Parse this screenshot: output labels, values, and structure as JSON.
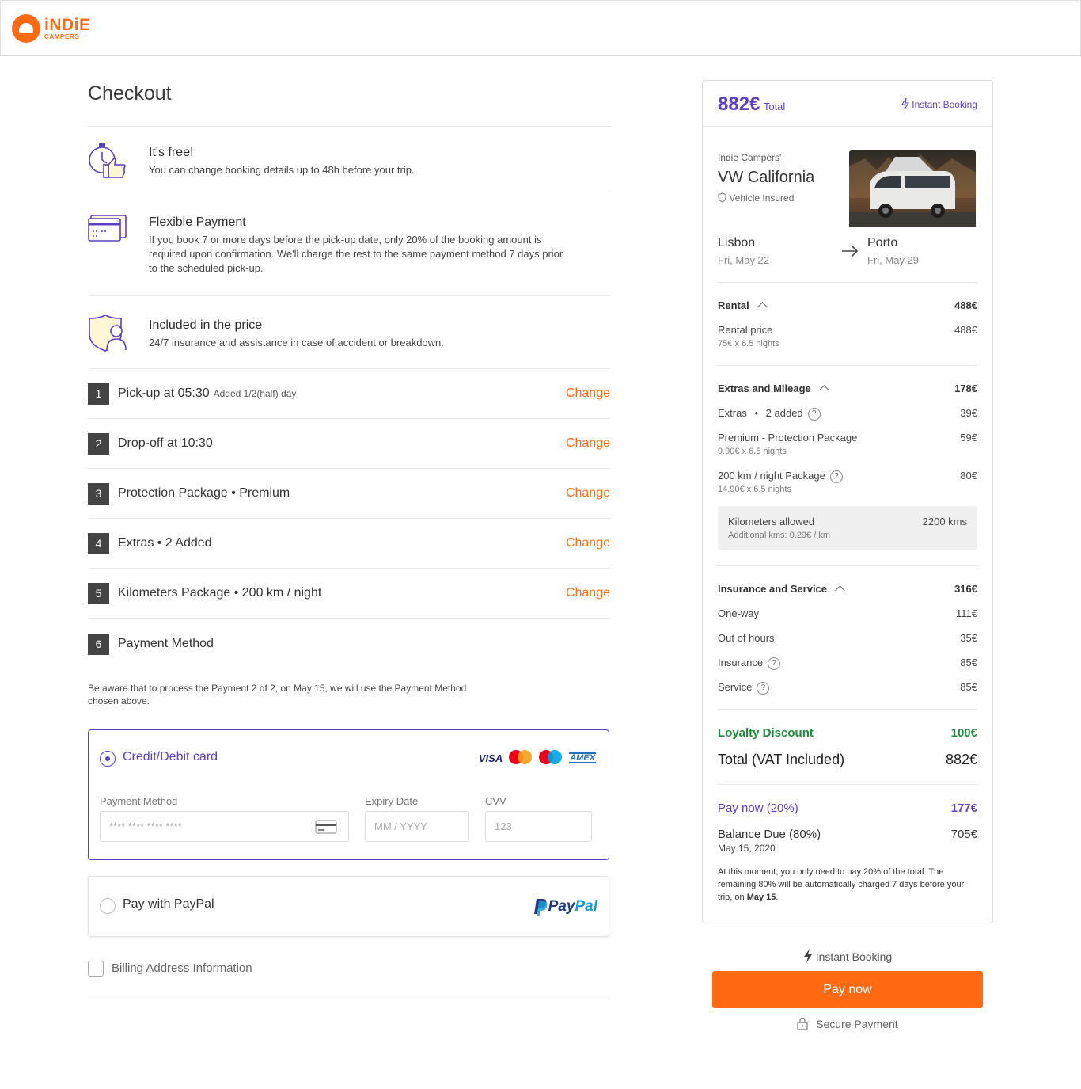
{
  "brand": {
    "name": "iNDiE",
    "sub": "CAMPERS",
    "color": "#ff6a13",
    "accent": "#5b3fc4"
  },
  "checkout": {
    "title": "Checkout",
    "info": [
      {
        "icon": "stopwatch-thumbs-up-icon",
        "title": "It's free!",
        "text": "You can change booking details up to 48h before your trip."
      },
      {
        "icon": "credit-card-calendar-icon",
        "title": "Flexible Payment",
        "text": "If you book 7 or more days before the pick-up date, only 20% of the booking amount is required upon confirmation. We'll charge the rest to the same payment method 7 days prior to the scheduled pick-up."
      },
      {
        "icon": "shield-person-icon",
        "title": "Included in the price",
        "text": "24/7 insurance and assistance in case of accident or breakdown."
      }
    ],
    "steps": [
      {
        "num": "1",
        "title": "Pick-up at 05:30",
        "sub": "Added 1/2(half) day",
        "action": "Change"
      },
      {
        "num": "2",
        "title": "Drop-off at 10:30",
        "sub": "",
        "action": "Change"
      },
      {
        "num": "3",
        "title": "Protection Package • Premium",
        "sub": "",
        "action": "Change"
      },
      {
        "num": "4",
        "title": "Extras • 2 Added",
        "sub": "",
        "action": "Change"
      },
      {
        "num": "5",
        "title": "Kilometers Package • 200 km / night",
        "sub": "",
        "action": "Change"
      },
      {
        "num": "6",
        "title": "Payment Method",
        "sub": "",
        "action": ""
      }
    ],
    "notice": "Be aware that to process the Payment 2 of 2, on May 15, we will use the Payment Method chosen above.",
    "card": {
      "title": "Credit/Debit card",
      "brands": [
        "VISA",
        "mastercard",
        "maestro",
        "AMEX"
      ],
      "payment_label": "Payment Method",
      "payment_placeholder": "**** **** **** ****",
      "expiry_label": "Expiry Date",
      "expiry_placeholder": "MM / YYYY",
      "cvv_label": "CVV",
      "cvv_placeholder": "123"
    },
    "paypal": {
      "title": "Pay with PayPal",
      "logo_a": "Pay",
      "logo_b": "Pal"
    },
    "billing": "Billing Address Information"
  },
  "summary": {
    "total_amount": "882€",
    "total_label": "Total",
    "instant": "Instant Booking",
    "vehicle_brand": "Indie Campers'",
    "vehicle_name": "VW California",
    "vehicle_insured": "Vehicle Insured",
    "from_city": "Lisbon",
    "from_date": "Fri, May 22",
    "to_city": "Porto",
    "to_date": "Fri, May 29",
    "rental": {
      "label": "Rental",
      "total": "488€",
      "item": "Rental price",
      "item_value": "488€",
      "item_sub": "75€ x 6.5 nights"
    },
    "extras": {
      "label": "Extras and Mileage",
      "total": "178€",
      "extras_label": "Extras",
      "extras_count": "2 added",
      "extras_value": "39€",
      "protection_label": "Premium - Protection Package",
      "protection_sub": "9.90€ x 6.5 nights",
      "protection_value": "59€",
      "km_label": "200 km / night Package",
      "km_sub": "14.90€ x 6.5 nights",
      "km_value": "80€",
      "allowed_label": "Kilometers allowed",
      "allowed_value": "2200 kms",
      "allowed_sub": "Additional kms: 0.29€ / km"
    },
    "insurance": {
      "label": "Insurance and Service",
      "total": "316€",
      "items": [
        {
          "label": "One-way",
          "value": "111€"
        },
        {
          "label": "Out of hours",
          "value": "35€"
        },
        {
          "label": "Insurance",
          "value": "85€"
        },
        {
          "label": "Service",
          "value": "85€"
        }
      ]
    },
    "loyalty_label": "Loyalty Discount",
    "loyalty_value": "100€",
    "vat_label": "Total (VAT Included)",
    "vat_value": "882€",
    "pay_now_label": "Pay now (20%)",
    "pay_now_value": "177€",
    "balance_label": "Balance Due (80%)",
    "balance_value": "705€",
    "balance_date": "May 15, 2020",
    "note_a": "At this moment, you only need to pay 20% of the total. The remaining 80% will be automatically charged 7 days before your trip, on ",
    "note_b": "May 15",
    "note_c": "."
  },
  "actions": {
    "instant": "Instant Booking",
    "pay": "Pay now",
    "secure": "Secure Payment"
  }
}
